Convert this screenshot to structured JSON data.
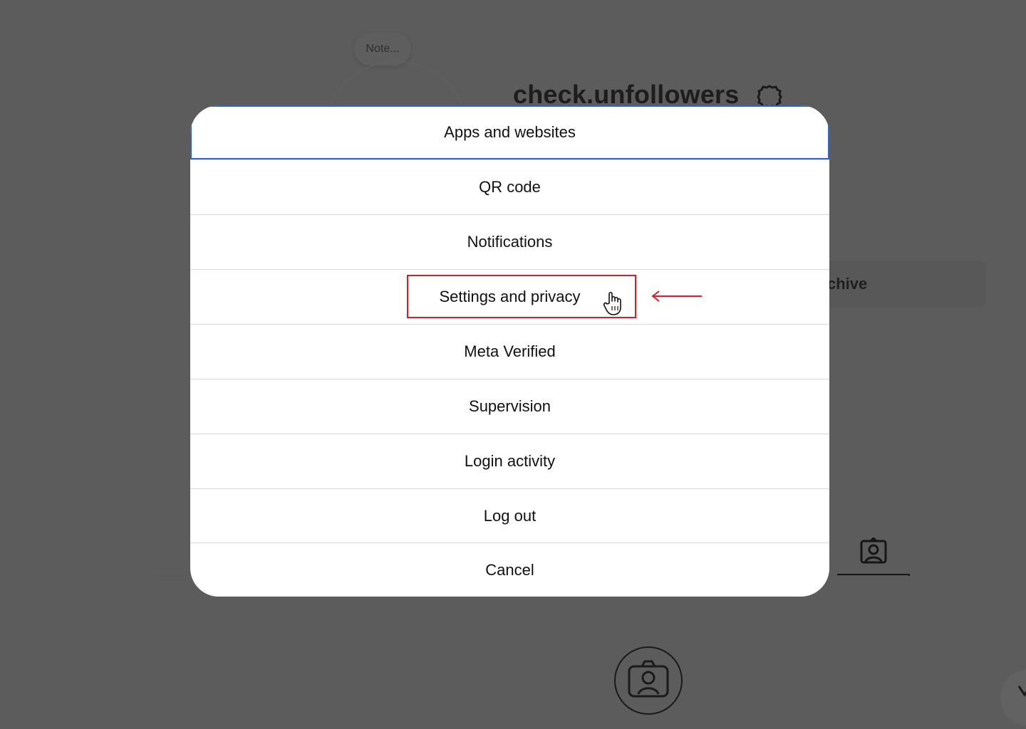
{
  "background": {
    "note_text": "Note...",
    "username": "check.unfollowers",
    "archive_text": "chive",
    "icons": [
      "gear-icon",
      "tagged-icon",
      "camera-icon"
    ]
  },
  "menu": {
    "items": [
      {
        "label": "Apps and websites",
        "focused": true
      },
      {
        "label": "QR code"
      },
      {
        "label": "Notifications"
      },
      {
        "label": "Settings and privacy",
        "highlighted": true
      },
      {
        "label": "Meta Verified"
      },
      {
        "label": "Supervision"
      },
      {
        "label": "Login activity"
      },
      {
        "label": "Log out"
      },
      {
        "label": "Cancel"
      }
    ]
  },
  "annotation": {
    "highlight_color": "#d21f2a",
    "arrow": "red-arrow",
    "cursor": "hand-cursor-icon"
  },
  "colors": {
    "overlay": "#5c5c5c",
    "modal": "#ffffff",
    "focus_ring": "#2f66cc",
    "divider": "#d9d9d9"
  }
}
